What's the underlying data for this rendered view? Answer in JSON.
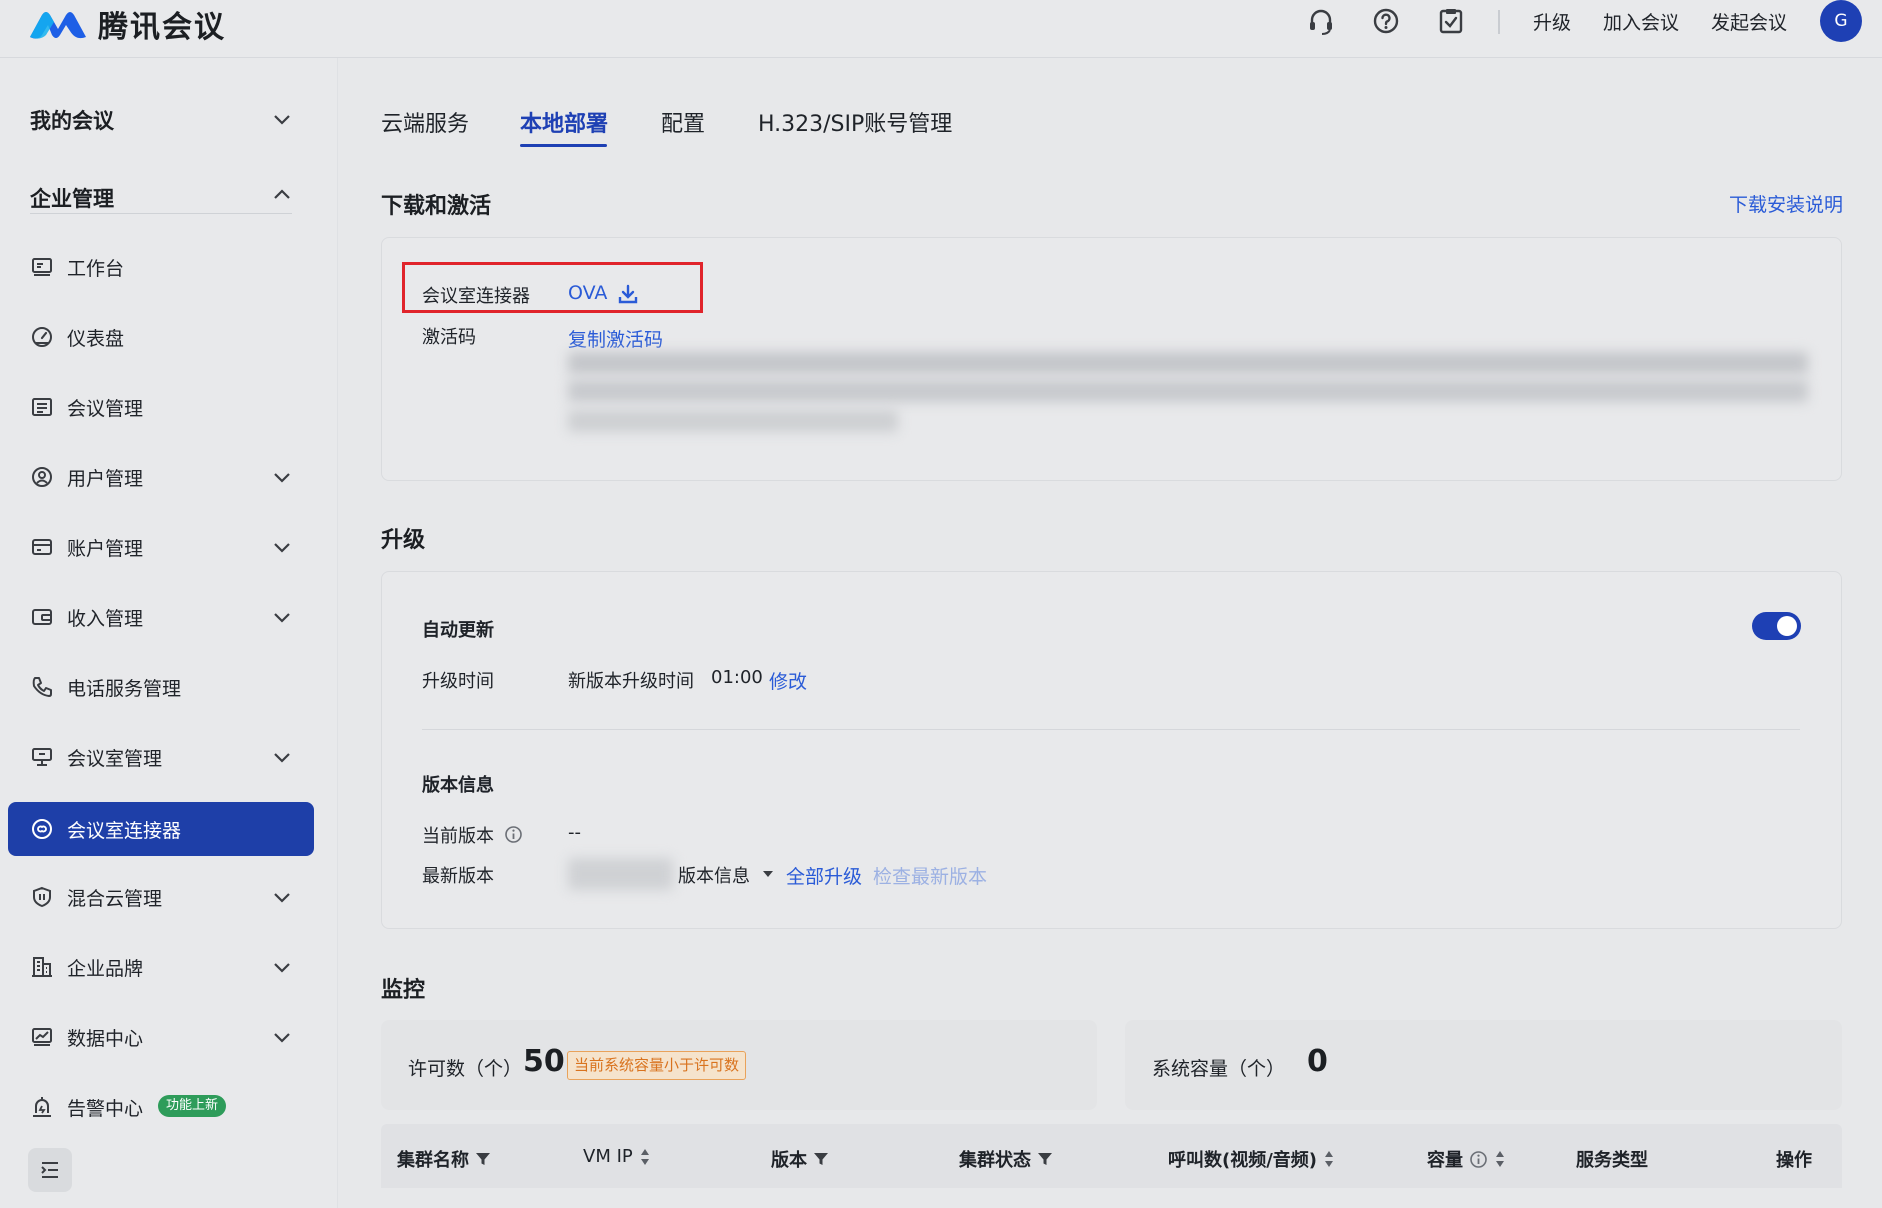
{
  "app": {
    "name": "腾讯会议"
  },
  "topbar": {
    "links": [
      "升级",
      "加入会议",
      "发起会议"
    ],
    "avatar": "G",
    "icons": [
      "headset-icon",
      "help-icon",
      "clipboard-check-icon"
    ]
  },
  "sidebar": {
    "groups": [
      {
        "label": "我的会议",
        "expanded": false
      },
      {
        "label": "企业管理",
        "expanded": true
      }
    ],
    "items": [
      {
        "label": "工作台",
        "icon": "workbench-icon",
        "has_children": false
      },
      {
        "label": "仪表盘",
        "icon": "dashboard-icon",
        "has_children": false
      },
      {
        "label": "会议管理",
        "icon": "list-icon",
        "has_children": false
      },
      {
        "label": "用户管理",
        "icon": "user-icon",
        "has_children": true
      },
      {
        "label": "账户管理",
        "icon": "card-icon",
        "has_children": true
      },
      {
        "label": "收入管理",
        "icon": "wallet-icon",
        "has_children": true
      },
      {
        "label": "电话服务管理",
        "icon": "phone-icon",
        "has_children": false
      },
      {
        "label": "会议室管理",
        "icon": "room-icon",
        "has_children": true
      },
      {
        "label": "会议室连接器",
        "icon": "connector-icon",
        "has_children": false,
        "active": true
      },
      {
        "label": "混合云管理",
        "icon": "hybrid-cloud-icon",
        "has_children": true
      },
      {
        "label": "企业品牌",
        "icon": "building-icon",
        "has_children": true
      },
      {
        "label": "数据中心",
        "icon": "chart-icon",
        "has_children": true
      },
      {
        "label": "告警中心",
        "icon": "alarm-icon",
        "has_children": false,
        "badge": "功能上新"
      }
    ]
  },
  "tabs": [
    {
      "label": "云端服务",
      "active": false
    },
    {
      "label": "本地部署",
      "active": true
    },
    {
      "label": "配置",
      "active": false
    },
    {
      "label": "H.323/SIP账号管理",
      "active": false
    }
  ],
  "download": {
    "title": "下载和激活",
    "help_link": "下载安装说明",
    "connector_label": "会议室连接器",
    "connector_format": "OVA",
    "activation_label": "激活码",
    "copy_activation": "复制激活码"
  },
  "upgrade": {
    "title": "升级",
    "auto_update_label": "自动更新",
    "auto_update_on": true,
    "time_label": "升级时间",
    "time_text": "新版本升级时间",
    "time_value": "01:00",
    "modify": "修改",
    "version_title": "版本信息",
    "current_label": "当前版本",
    "current_value": "--",
    "latest_label": "最新版本",
    "version_info": "版本信息",
    "upgrade_all": "全部升级",
    "check_latest": "检查最新版本"
  },
  "monitor": {
    "title": "监控",
    "license_label": "许可数（个）",
    "license_value": "50",
    "warning": "当前系统容量小于许可数",
    "capacity_label": "系统容量（个）",
    "capacity_value": "0",
    "columns": [
      "集群名称",
      "VM IP",
      "版本",
      "集群状态",
      "呼叫数(视频/音频)",
      "容量",
      "服务类型",
      "操作"
    ]
  },
  "colors": {
    "accent": "#1e40b4",
    "link": "#2a5bd7",
    "warning": "#d9731e",
    "highlight": "#e0242b",
    "new_badge": "#2e9c5a"
  }
}
